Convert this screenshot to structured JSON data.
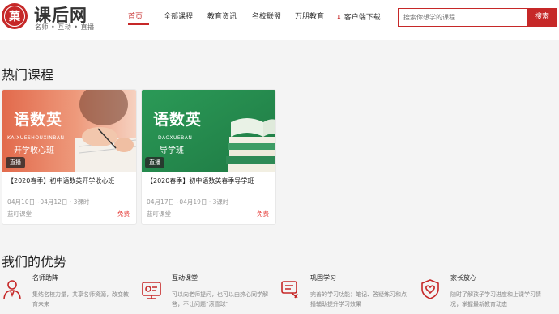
{
  "header": {
    "logo_seal_text": "菓",
    "logo_name": "课后网",
    "logo_slogan": "名师 • 互动 • 直播",
    "nav": [
      {
        "label": "首页",
        "active": true
      },
      {
        "label": "全部课程",
        "active": false
      },
      {
        "label": "教育资讯",
        "active": false
      },
      {
        "label": "名校联盟",
        "active": false
      },
      {
        "label": "万朋教育",
        "active": false
      },
      {
        "label": "客户端下载",
        "active": false,
        "icon": "download-icon"
      }
    ],
    "search": {
      "placeholder": "搜索你想学的课程",
      "button_label": "搜索"
    }
  },
  "hot": {
    "title": "热门课程",
    "courses": [
      {
        "image_title": "语数英",
        "image_pinyin": "KAIXUESHOUXINBAN",
        "image_subtitle": "开学收心班",
        "badge": "直播",
        "title": "【2020春季】初中语数英开学收心班",
        "date": "04月10日~04月12日 · 3课时",
        "org": "蓝叮课堂",
        "price": "免费",
        "theme_color": "#e8775a"
      },
      {
        "image_title": "语数英",
        "image_pinyin": "DAOXUEBAN",
        "image_subtitle": "导学班",
        "badge": "直播",
        "title": "【2020春季】初中语数英春季导学班",
        "date": "04月17日~04月19日 · 3课时",
        "org": "蓝叮课堂",
        "price": "免费",
        "theme_color": "#2e9a5a"
      }
    ]
  },
  "advantages": {
    "title": "我们的优势",
    "items": [
      {
        "icon": "teacher-icon",
        "title": "名师助阵",
        "desc": "集结名校力量，共享名师资源，改变教育未来"
      },
      {
        "icon": "interactive-class-icon",
        "title": "互动课堂",
        "desc": "可以向老师提问，也可以由热心同学解答，不让问题“滚雪球”"
      },
      {
        "icon": "practice-icon",
        "title": "巩固学习",
        "desc": "完善的学习功能：笔记、答疑练习和点播辅助提升学习效果"
      },
      {
        "icon": "parent-heart-icon",
        "title": "家长放心",
        "desc": "随时了解孩子学习进度和上课学习情况，掌握最新教育动态"
      }
    ]
  },
  "colors": {
    "brand": "#c62828",
    "price": "#e53935"
  }
}
